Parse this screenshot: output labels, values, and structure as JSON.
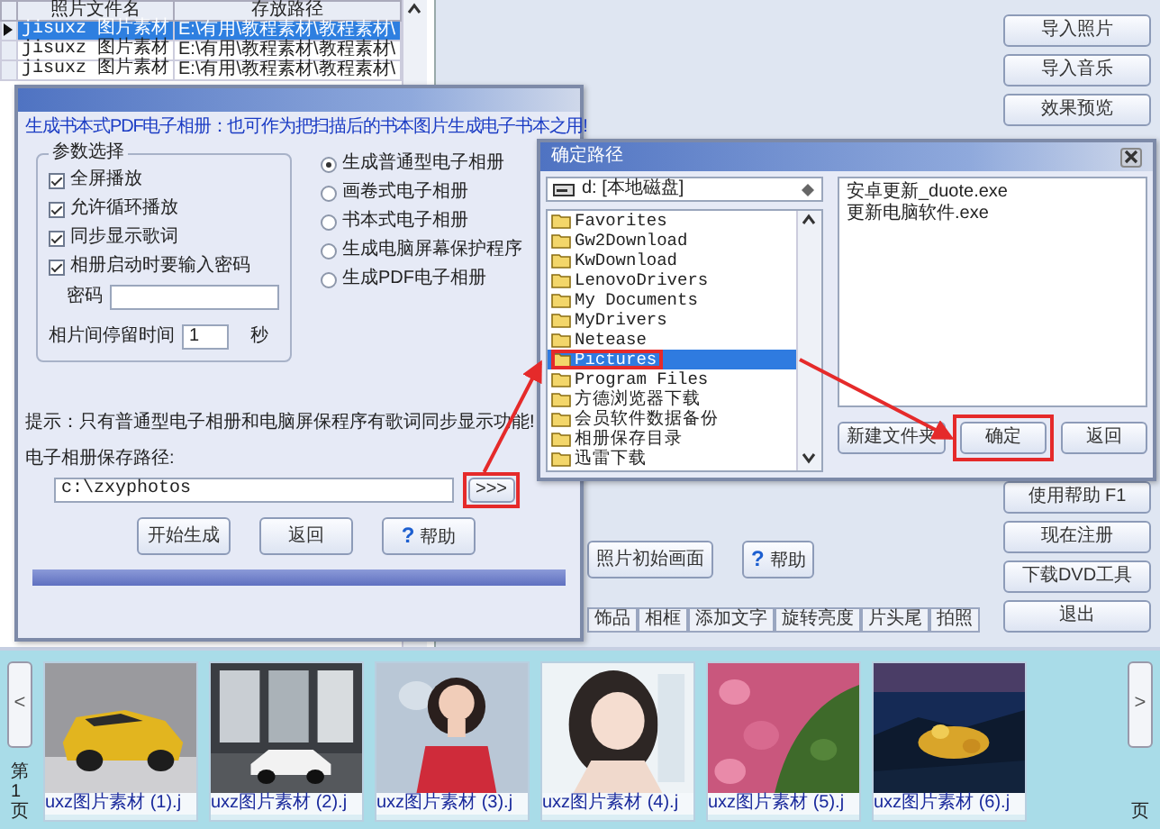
{
  "photo_table": {
    "columns": [
      "照片文件名",
      "存放路径"
    ],
    "rows": [
      {
        "cells": [
          "jisuxz 图片素材",
          "E:\\有用\\教程素材\\教程素材\\"
        ],
        "selected": true
      },
      {
        "cells": [
          "jisuxz 图片素材",
          "E:\\有用\\教程素材\\教程素材\\"
        ],
        "selected": false
      },
      {
        "cells": [
          "jisuxz 图片素材",
          "E:\\有用\\教程素材\\教程素材\\"
        ],
        "selected": false
      }
    ]
  },
  "side_buttons_top": [
    "导入照片",
    "导入音乐",
    "效果预览"
  ],
  "side_buttons_bottom": [
    "使用帮助  F1",
    "现在注册",
    "下载DVD工具",
    "退出"
  ],
  "main_buttons": [
    {
      "label": "照片初始画面",
      "kind": "plain"
    },
    {
      "label": "帮助",
      "kind": "help",
      "icon": "?"
    }
  ],
  "effect_tabs": [
    "饰品",
    "相框",
    "添加文字",
    "旋转亮度",
    "片头尾",
    "拍照"
  ],
  "thumbnail_strip": {
    "prev": "<",
    "next": ">",
    "page_label": "第1页",
    "right_label": "页",
    "thumbnails": [
      {
        "caption": "uxz图片素材 (1).j",
        "kind": "picture"
      },
      {
        "caption": "uxz图片素材 (2).j",
        "kind": "picture"
      },
      {
        "caption": "uxz图片素材 (3).j",
        "kind": "picture"
      },
      {
        "caption": "uxz图片素材 (4).j",
        "kind": "picture"
      },
      {
        "caption": "uxz图片素材 (5).j",
        "kind": "picture"
      },
      {
        "caption": "uxz图片素材 (6).j",
        "kind": "picture"
      }
    ]
  },
  "album_dialog": {
    "heading": "生成书本式PDF电子相册：也可作为把扫描后的书本图片生成电子书本之用!",
    "group_title": "参数选择",
    "options": [
      {
        "label": "全屏播放",
        "checked": true
      },
      {
        "label": "允许循环播放",
        "checked": true
      },
      {
        "label": "同步显示歌词",
        "checked": true
      },
      {
        "label": "相册启动时要输入密码",
        "checked": true
      }
    ],
    "password_label": "密码",
    "interval_label": "相片间停留时间",
    "interval_value": "1",
    "interval_unit": "秒",
    "album_types": [
      {
        "label": "生成普通型电子相册",
        "selected": true
      },
      {
        "label": "画卷式电子相册",
        "selected": false
      },
      {
        "label": "书本式电子相册",
        "selected": false
      },
      {
        "label": "生成电脑屏幕保护程序",
        "selected": false
      },
      {
        "label": "生成PDF电子相册",
        "selected": false
      }
    ],
    "hint": "提示：只有普通型电子相册和电脑屏保程序有歌词同步显示功能!",
    "save_path_label": "电子相册保存路径:",
    "save_path": "c:\\zxyphotos",
    "browse_button": ">>>",
    "buttons": [
      {
        "label": "开始生成",
        "kind": "plain"
      },
      {
        "label": "返回",
        "kind": "plain"
      },
      {
        "label": "帮助",
        "kind": "help",
        "icon": "?"
      }
    ]
  },
  "path_dialog": {
    "title": "确定路径",
    "drive": "d: [本地磁盘]",
    "folders": [
      {
        "name": "Favorites",
        "selected": false
      },
      {
        "name": "Gw2Download",
        "selected": false
      },
      {
        "name": "KwDownload",
        "selected": false
      },
      {
        "name": "LenovoDrivers",
        "selected": false
      },
      {
        "name": "My Documents",
        "selected": false
      },
      {
        "name": "MyDrivers",
        "selected": false
      },
      {
        "name": "Netease",
        "selected": false
      },
      {
        "name": "Pictures",
        "selected": true
      },
      {
        "name": "Program Files",
        "selected": false
      },
      {
        "name": "方德浏览器下载",
        "selected": false
      },
      {
        "name": "会员软件数据备份",
        "selected": false
      },
      {
        "name": "相册保存目录",
        "selected": false
      },
      {
        "name": "迅雷下载",
        "selected": false
      }
    ],
    "files": [
      "安卓更新_duote.exe",
      "更新电脑软件.exe"
    ],
    "buttons": [
      "新建文件夹",
      "确定",
      "返回"
    ]
  }
}
